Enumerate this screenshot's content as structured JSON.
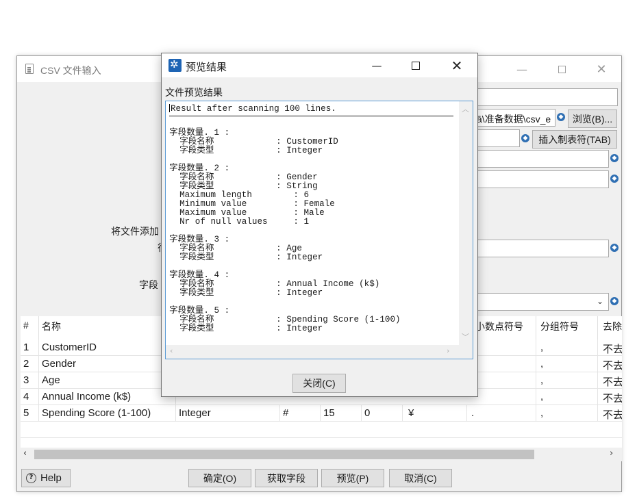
{
  "background_window": {
    "title": "CSV 文件输入",
    "filename_value": "ā\\准备数据\\csv_e",
    "browse_label": "浏览(B)...",
    "insert_tab_label": "插入制表符(TAB)",
    "labels": {
      "add_file_to_result": "将文件添加",
      "row_label_fragment": "行",
      "field_label_fragment": "字段"
    },
    "table": {
      "headers": [
        "#",
        "名称",
        "小数点符号",
        "分组符号",
        "去除"
      ],
      "rows": [
        {
          "num": "1",
          "name": "CustomerID",
          "group": ",",
          "trim": "不去"
        },
        {
          "num": "2",
          "name": "Gender",
          "group": ",",
          "trim": "不去"
        },
        {
          "num": "3",
          "name": "Age",
          "group": ",",
          "trim": "不去"
        },
        {
          "num": "4",
          "name": "Annual Income (k$)",
          "group": ",",
          "trim": "不去"
        },
        {
          "num": "5",
          "name": "Spending Score (1-100)",
          "type": "Integer",
          "format": "#",
          "length": "15",
          "precision": "0",
          "currency": "¥",
          "decimal": ".",
          "group": ",",
          "trim": "不去"
        }
      ]
    },
    "buttons": {
      "help": "Help",
      "ok": "确定(O)",
      "get_fields": "获取字段",
      "preview": "预览(P)",
      "cancel": "取消(C)"
    }
  },
  "preview_dialog": {
    "title": "预览结果",
    "section_label": "文件预览结果",
    "header_line": "Result after scanning 100 lines.",
    "body_lines": [
      "",
      "字段数量. 1 :",
      "  字段名称            : CustomerID",
      "  字段类型            : Integer",
      "",
      "字段数量. 2 :",
      "  字段名称            : Gender",
      "  字段类型            : String",
      "  Maximum length        : 6",
      "  Minimum value         : Female",
      "  Maximum value         : Male",
      "  Nr of null values     : 1",
      "",
      "字段数量. 3 :",
      "  字段名称            : Age",
      "  字段类型            : Integer",
      "",
      "字段数量. 4 :",
      "  字段名称            : Annual Income (k$)",
      "  字段类型            : Integer",
      "",
      "字段数量. 5 :",
      "  字段名称            : Spending Score (1-100)",
      "  字段类型            : Integer"
    ],
    "close_label": "关闭(C)"
  }
}
